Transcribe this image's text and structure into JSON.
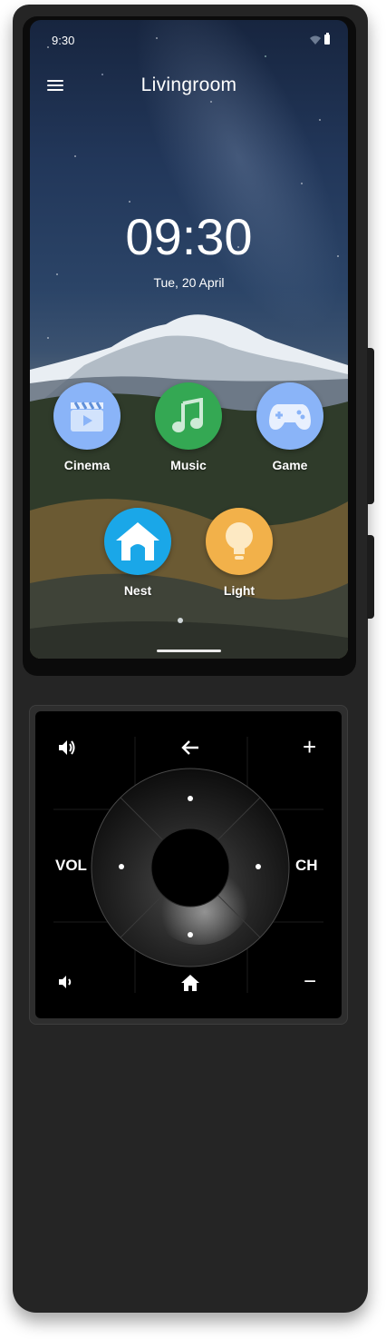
{
  "status_bar": {
    "time": "9:30",
    "icons": [
      "wifi-icon",
      "battery-icon"
    ]
  },
  "header": {
    "menu_icon": "menu-icon",
    "room": "Livingroom"
  },
  "lockscreen": {
    "clock": "09:30",
    "date": "Tue, 20 April"
  },
  "apps": [
    {
      "label": "Cinema",
      "icon": "clapperboard-icon",
      "color": "#8ab4f8"
    },
    {
      "label": "Music",
      "icon": "music-note-icon",
      "color": "#34a853"
    },
    {
      "label": "Game",
      "icon": "gamepad-icon",
      "color": "#8ab4f8"
    },
    {
      "label": "Nest",
      "icon": "home-icon",
      "color": "#1aa7e8"
    },
    {
      "label": "Light",
      "icon": "lightbulb-icon",
      "color": "#f2b14a"
    }
  ],
  "pager": {
    "pages": 1,
    "active": 0
  },
  "remote": {
    "vol_label": "VOL",
    "ch_label": "CH",
    "back_icon": "arrow-left-icon",
    "plus_symbol": "+",
    "minus_symbol": "−",
    "volume_up_icon": "volume-up-icon",
    "volume_down_icon": "volume-down-icon",
    "home_icon": "home-icon"
  },
  "colors": {
    "device": "#252525",
    "pad": "#000000",
    "accent_blue": "#8ab4f8",
    "accent_green": "#34a853",
    "accent_amber": "#f2b14a"
  }
}
